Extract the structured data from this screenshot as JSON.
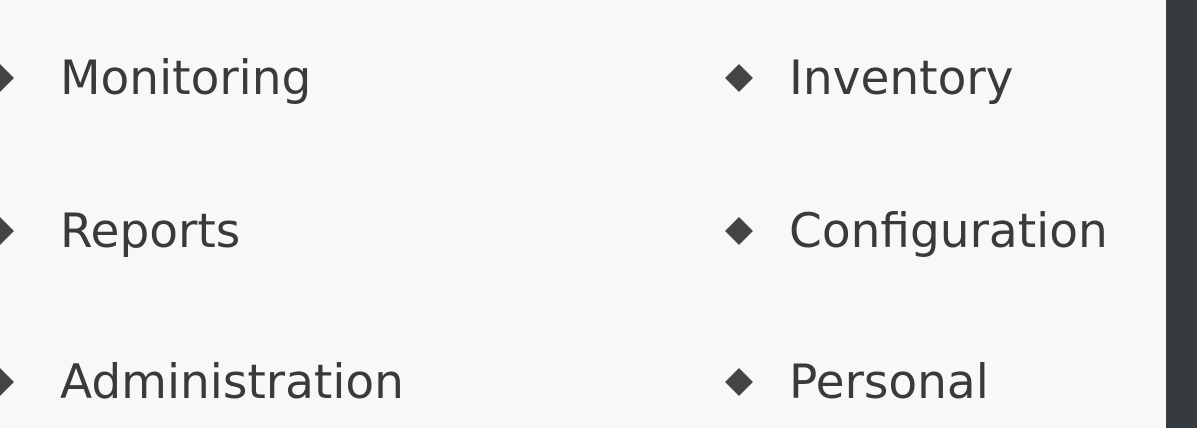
{
  "menu": {
    "items": [
      {
        "label": "Monitoring",
        "icon": "diamond-bullet-icon"
      },
      {
        "label": "Reports",
        "icon": "diamond-bullet-icon"
      },
      {
        "label": "Administration",
        "icon": "diamond-bullet-icon"
      },
      {
        "label": "Inventory",
        "icon": "diamond-bullet-icon"
      },
      {
        "label": "Configuration",
        "icon": "diamond-bullet-icon"
      },
      {
        "label": "Personal",
        "icon": "diamond-bullet-icon"
      }
    ]
  },
  "colors": {
    "background": "#f8f8f8",
    "text": "#3a3a3a",
    "bullet": "#444444",
    "side_panel": "#363b40"
  }
}
